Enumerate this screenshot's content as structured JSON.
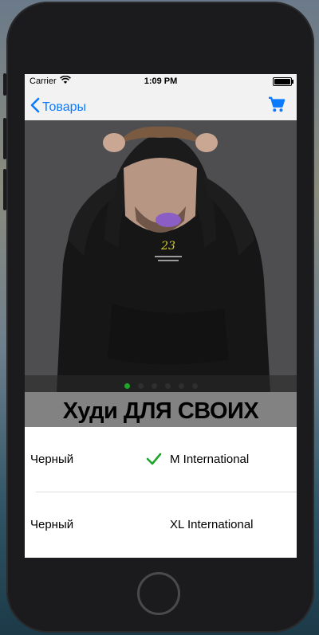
{
  "status": {
    "carrier": "Carrier",
    "time": "1:09 PM"
  },
  "nav": {
    "back_label": "Товары"
  },
  "product": {
    "title": "Худи ДЛЯ СВОИХ",
    "carousel_count": 6,
    "active_index": 0
  },
  "variants": [
    {
      "color": "Черный",
      "size": "M International",
      "selected": true
    },
    {
      "color": "Черный",
      "size": "XL International",
      "selected": false
    }
  ],
  "colors": {
    "accent": "#0a7aff",
    "check": "#1fa52b",
    "dot_active": "#1fa52b"
  },
  "icons": {
    "back": "chevron-left-icon",
    "cart": "cart-icon",
    "check": "checkmark-icon",
    "wifi": "wifi-icon",
    "battery": "battery-icon"
  }
}
